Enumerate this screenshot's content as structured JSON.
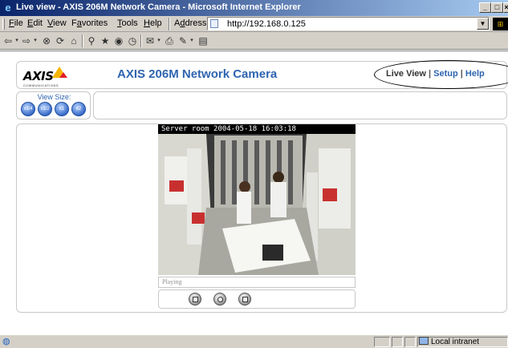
{
  "window": {
    "title": "Live view - AXIS 206M Network Camera - Microsoft Internet Explorer",
    "minimize_glyph": "_",
    "maximize_glyph": "□",
    "close_glyph": "×"
  },
  "menubar": {
    "items": [
      {
        "mnemonic": "F",
        "rest": "ile"
      },
      {
        "mnemonic": "E",
        "rest": "dit"
      },
      {
        "mnemonic": "V",
        "rest": "iew"
      },
      {
        "pre": "F",
        "mnemonic": "a",
        "rest": "vorites"
      },
      {
        "mnemonic": "T",
        "rest": "ools"
      },
      {
        "mnemonic": "H",
        "rest": "elp"
      }
    ],
    "address_label_pre": "A",
    "address_label_mn": "d",
    "address_label_rest": "dress",
    "address_value": "http://192.168.0.125"
  },
  "toolbar": {
    "icons": [
      "back-icon",
      "forward-icon",
      "stop-icon",
      "refresh-icon",
      "home-icon",
      "search-icon",
      "favorites-icon",
      "media-icon",
      "history-icon",
      "mail-icon",
      "print-icon",
      "edit-icon",
      "discuss-icon"
    ]
  },
  "page": {
    "logo_text": "AXIS",
    "logo_sub": "COMMUNICATIONS",
    "product_title": "AXIS 206M Network Camera",
    "nav": {
      "live_view": "Live View",
      "sep1": "|",
      "setup": "Setup",
      "sep2": "|",
      "help": "Help"
    },
    "view_size_label": "View Size:",
    "view_size_buttons": [
      "x1/4",
      "x1/2",
      "x1",
      "x2"
    ],
    "video_overlay": "Server room  2004-05-18 16:03:18",
    "player_status": "Playing",
    "controls": [
      "stop-button",
      "snapshot-button",
      "fullscreen-button"
    ]
  },
  "statusbar": {
    "zone": "Local intranet"
  },
  "colors": {
    "accent": "#2e64b0",
    "titlebar_start": "#0a246a",
    "chrome": "#d4d0c8"
  }
}
